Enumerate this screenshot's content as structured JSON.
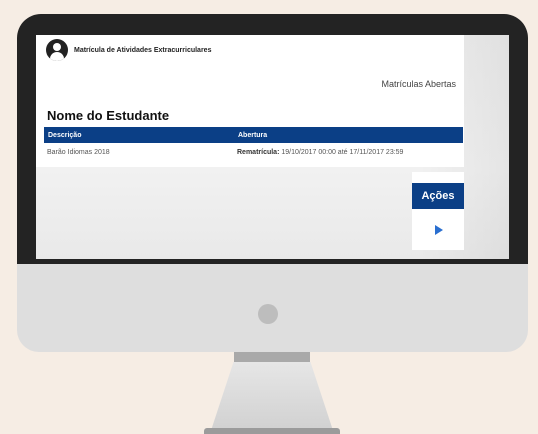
{
  "app": {
    "title": "Matrícula de Atividades Extracurriculares"
  },
  "page": {
    "section_link": "Matrículas Abertas",
    "student_name": "Nome do Estudante"
  },
  "table": {
    "columns": [
      "Descrição",
      "Abertura"
    ],
    "rows": [
      {
        "descricao": "Barão Idiomas 2018",
        "abertura_label": "Rematrícula:",
        "abertura_value": "19/10/2017 00:00 até 17/11/2017 23:59"
      }
    ]
  },
  "actions": {
    "header": "Ações",
    "icons": [
      "play-icon"
    ]
  }
}
